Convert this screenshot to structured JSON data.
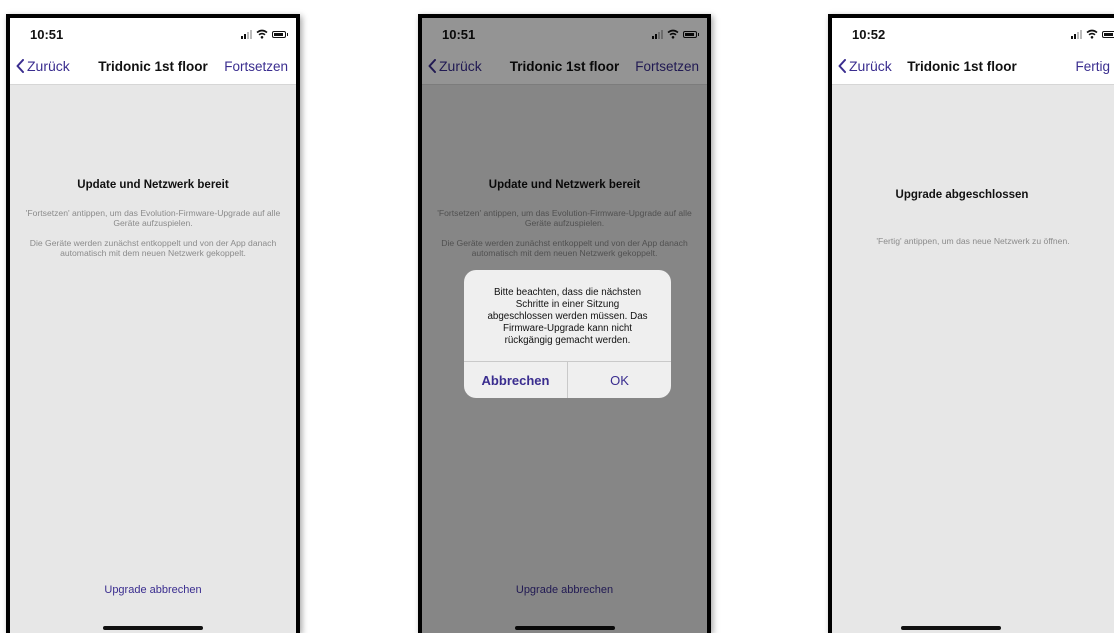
{
  "screens": [
    {
      "time": "10:51",
      "back_label": "Zurück",
      "title": "Tridonic 1st floor",
      "action_label": "Fortsetzen",
      "heading": "Update und Netzwerk bereit",
      "text_1": "'Fortsetzen' antippen, um das Evolution-Firmware-Upgrade auf alle Geräte aufzuspielen.",
      "text_2": "Die Geräte werden zunächst entkoppelt und von der App danach automatisch mit dem neuen Netzwerk gekoppelt.",
      "bottom_link": "Upgrade abbrechen"
    },
    {
      "time": "10:51",
      "back_label": "Zurück",
      "title": "Tridonic 1st floor",
      "action_label": "Fortsetzen",
      "heading": "Update und Netzwerk bereit",
      "text_1": "'Fortsetzen' antippen, um das Evolution-Firmware-Upgrade auf alle Geräte aufzuspielen.",
      "text_2": "Die Geräte werden zunächst entkoppelt und von der App danach automatisch mit dem neuen Netzwerk gekoppelt.",
      "bottom_link": "Upgrade abbrechen",
      "alert": {
        "message": "Bitte beachten, dass die nächsten\nSchritte in einer Sitzung\nabgeschlossen werden müssen. Das\nFirmware-Upgrade kann nicht\nrückgängig gemacht werden.",
        "cancel_label": "Abbrechen",
        "ok_label": "OK"
      }
    },
    {
      "time": "10:52",
      "back_label": "Zurück",
      "title": "Tridonic 1st floor",
      "action_label": "Fertig",
      "heading": "Upgrade abgeschlossen",
      "text_1": "'Fertig' antippen, um das neue Netzwerk zu öffnen."
    }
  ],
  "icons": {
    "signal": "signal-icon",
    "wifi": "wifi-icon",
    "battery": "battery-icon",
    "back": "chevron-left-icon"
  },
  "colors": {
    "accent": "#3a2d8f",
    "screen_background": "#e7e7e7",
    "secondary_text": "#8b8b8b"
  }
}
